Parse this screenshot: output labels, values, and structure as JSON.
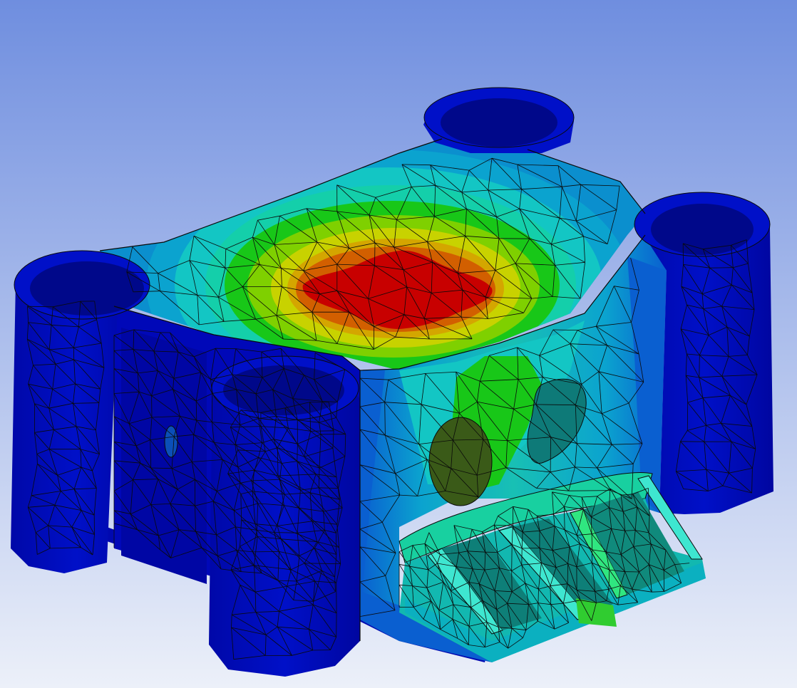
{
  "viewport": {
    "background_top": "#6f8edf",
    "background_bottom": "#ecf0f9"
  },
  "model": {
    "contour_palette": [
      "#0000c4",
      "#0a5fd0",
      "#0ba3cf",
      "#13c6c4",
      "#14cf8a",
      "#18c718",
      "#7fd000",
      "#c8d200",
      "#d4a600",
      "#d25f00",
      "#c80000"
    ],
    "mesh_line_color": "#0a0a0a"
  }
}
